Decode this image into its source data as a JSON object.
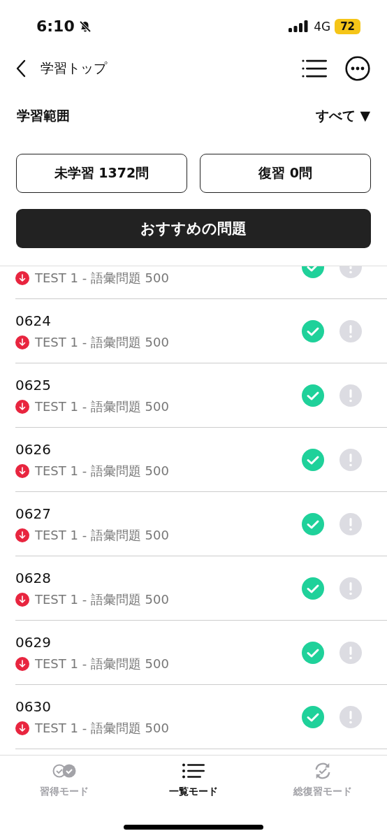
{
  "status_bar": {
    "time": "6:10",
    "network": "4G",
    "battery": "72"
  },
  "nav": {
    "title": "学習トップ"
  },
  "range": {
    "label": "学習範囲",
    "value": "すべて ▼"
  },
  "counts": [
    {
      "label": "未学習 1372問"
    },
    {
      "label": "復習 0問"
    }
  ],
  "recommend_button": "おすすめの問題",
  "items": [
    {
      "source": "TEST 1 - 語彙問題 500",
      "learned": true,
      "flagged": false
    },
    {
      "number": "0624",
      "source": "TEST 1 - 語彙問題 500",
      "learned": true,
      "flagged": false
    },
    {
      "number": "0625",
      "source": "TEST 1 - 語彙問題 500",
      "learned": true,
      "flagged": false
    },
    {
      "number": "0626",
      "source": "TEST 1 - 語彙問題 500",
      "learned": true,
      "flagged": false
    },
    {
      "number": "0627",
      "source": "TEST 1 - 語彙問題 500",
      "learned": true,
      "flagged": false
    },
    {
      "number": "0628",
      "source": "TEST 1 - 語彙問題 500",
      "learned": true,
      "flagged": false
    },
    {
      "number": "0629",
      "source": "TEST 1 - 語彙問題 500",
      "learned": true,
      "flagged": false
    },
    {
      "number": "0630",
      "source": "TEST 1 - 語彙問題 500",
      "learned": true,
      "flagged": false
    }
  ],
  "tabs": [
    {
      "label": "習得モード",
      "kind": "learn",
      "selected": false
    },
    {
      "label": "一覧モード",
      "kind": "list",
      "selected": true
    },
    {
      "label": "総復習モード",
      "kind": "review",
      "selected": false
    }
  ]
}
